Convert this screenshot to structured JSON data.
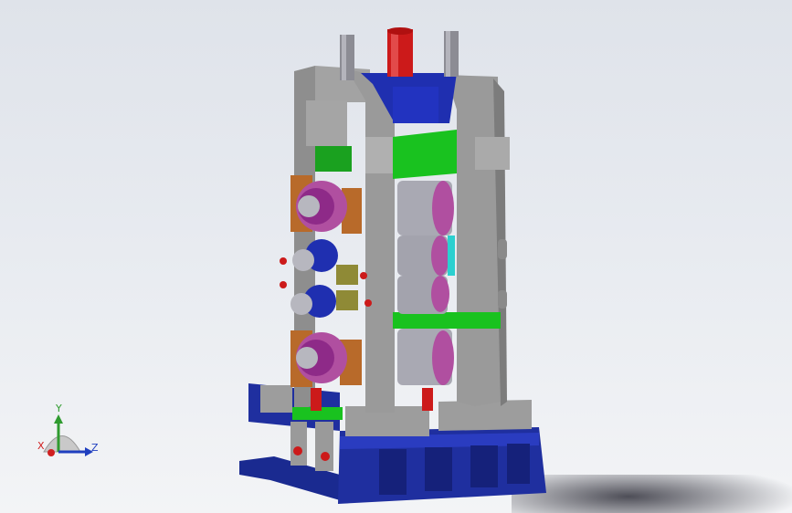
{
  "viewport": {
    "background_top": "#dfe3ea",
    "background_bottom": "#f3f4f6"
  },
  "triad": {
    "x_label": "X",
    "y_label": "Y",
    "z_label": "Z",
    "x_color": "#d02020",
    "y_color": "#2f9b2f",
    "z_color": "#1f3fbf"
  },
  "model": {
    "frame_color": "#9a9a9a",
    "base_color": "#1f2f9f",
    "plate_color": "#19c21f",
    "roll_color": "#a9a9b3",
    "bearing_color": "#b04fa0",
    "chock_color": "#b86a2a",
    "cylinder_color": "#cc1a1a"
  }
}
